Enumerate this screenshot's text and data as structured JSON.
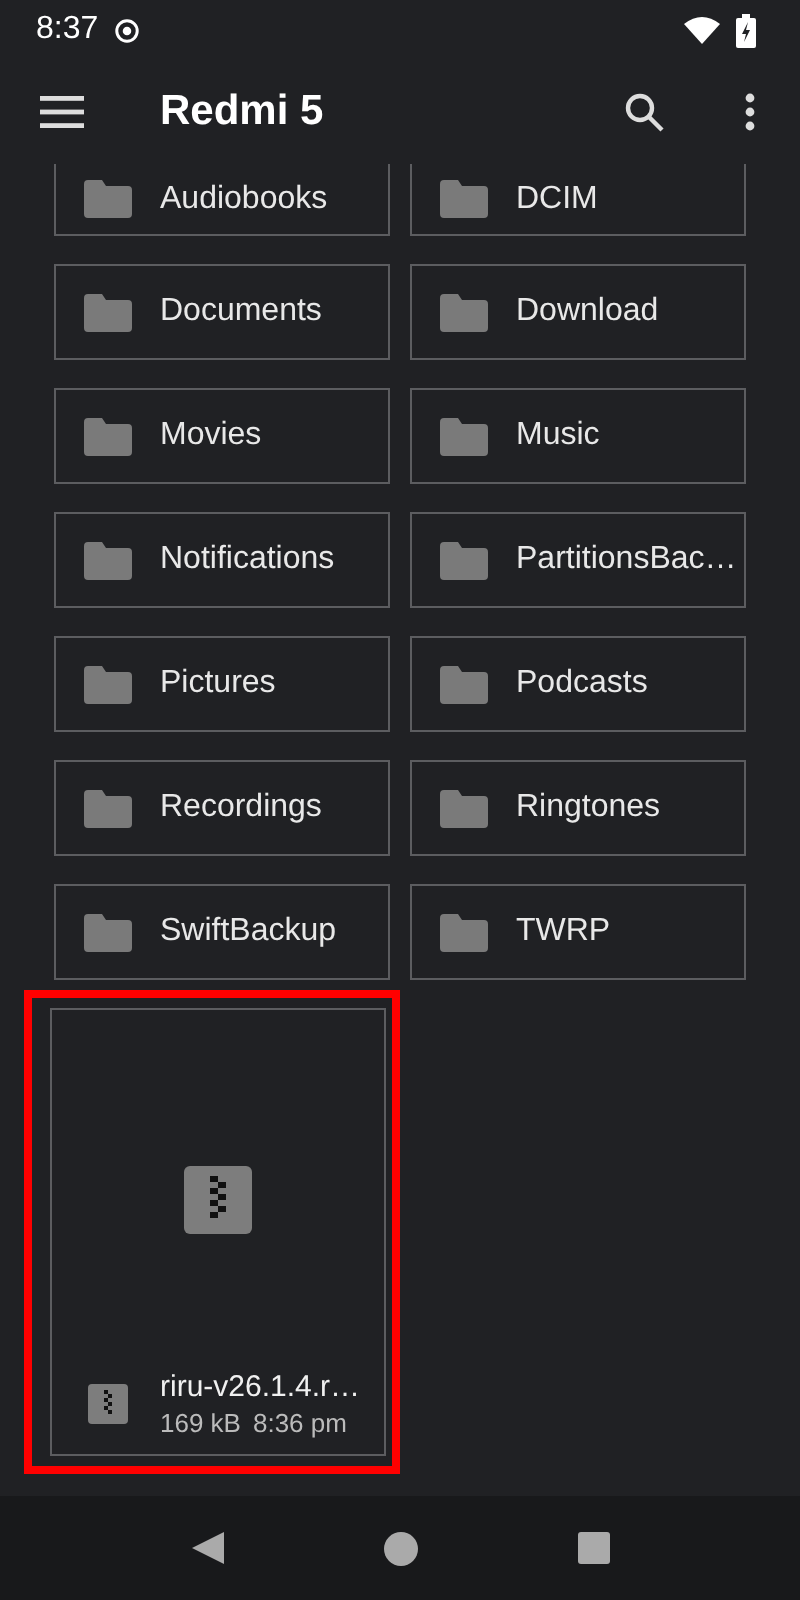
{
  "status_bar": {
    "time": "8:37"
  },
  "app_bar": {
    "title": "Redmi 5"
  },
  "folders": [
    {
      "name": "Audiobooks"
    },
    {
      "name": "DCIM"
    },
    {
      "name": "Documents"
    },
    {
      "name": "Download"
    },
    {
      "name": "Movies"
    },
    {
      "name": "Music"
    },
    {
      "name": "Notifications"
    },
    {
      "name": "PartitionsBac…"
    },
    {
      "name": "Pictures"
    },
    {
      "name": "Podcasts"
    },
    {
      "name": "Recordings"
    },
    {
      "name": "Ringtones"
    },
    {
      "name": "SwiftBackup"
    },
    {
      "name": "TWRP"
    }
  ],
  "files": [
    {
      "name": "riru-v26.1.4.r…",
      "size": "169 kB",
      "time": "8:36 pm",
      "highlighted": true
    }
  ]
}
